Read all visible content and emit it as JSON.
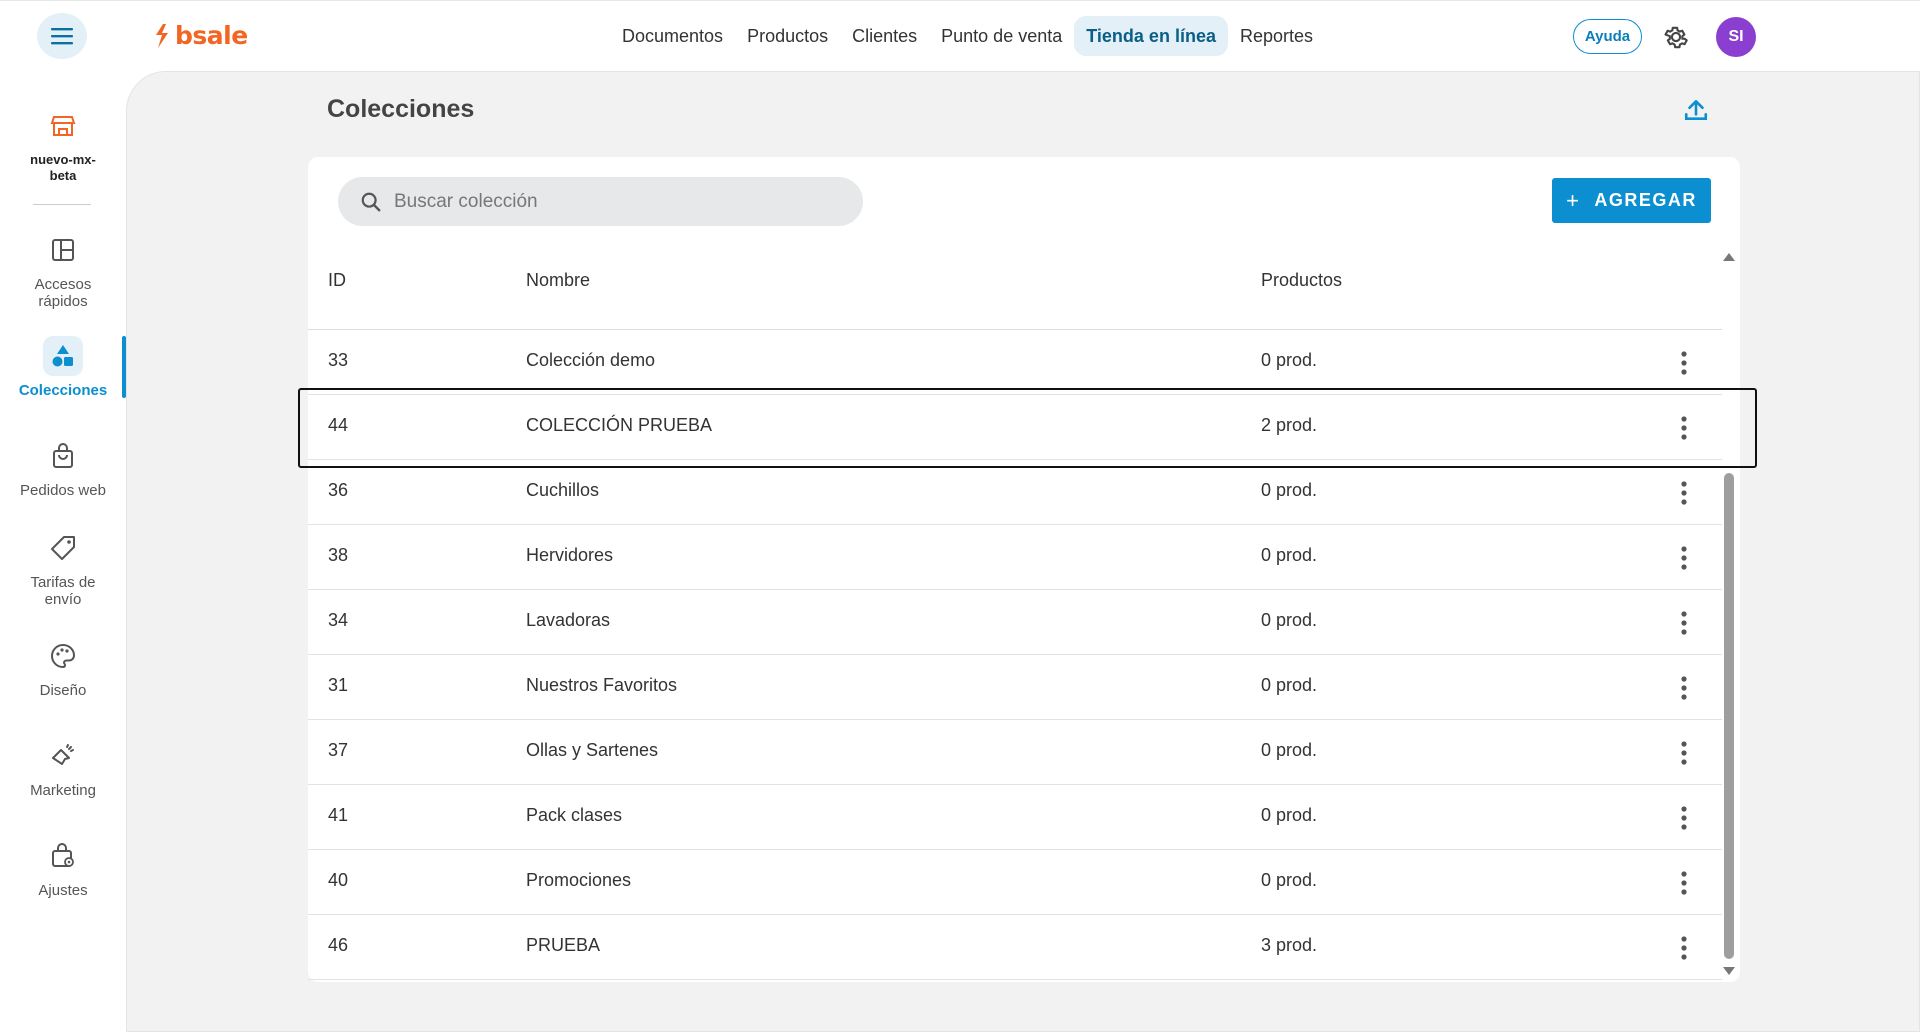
{
  "header": {
    "logo_text": "bsale",
    "nav": [
      {
        "label": "Documentos"
      },
      {
        "label": "Productos"
      },
      {
        "label": "Clientes"
      },
      {
        "label": "Punto de venta"
      },
      {
        "label": "Tienda en línea"
      },
      {
        "label": "Reportes"
      }
    ],
    "active_nav": "Tienda en línea",
    "help_label": "Ayuda",
    "avatar_initials": "SI"
  },
  "sidebar": {
    "store_name_line1": "nuevo-mx-",
    "store_name_line2": "beta",
    "items": [
      {
        "label1": "Accesos",
        "label2": "rápidos",
        "icon": "layout-icon"
      },
      {
        "label1": "Colecciones",
        "label2": "",
        "icon": "shapes-icon"
      },
      {
        "label1": "Pedidos web",
        "label2": "",
        "icon": "shopping-bag-icon"
      },
      {
        "label1": "Tarifas de",
        "label2": "envío",
        "icon": "tag-icon"
      },
      {
        "label1": "Diseño",
        "label2": "",
        "icon": "palette-icon"
      },
      {
        "label1": "Marketing",
        "label2": "",
        "icon": "megaphone-icon"
      },
      {
        "label1": "Ajustes",
        "label2": "",
        "icon": "settings-bag-icon"
      }
    ],
    "active_item": "Colecciones"
  },
  "main": {
    "title": "Colecciones",
    "search_placeholder": "Buscar colección",
    "add_label": "AGREGAR",
    "columns": {
      "id": "ID",
      "name": "Nombre",
      "products": "Productos"
    },
    "rows": [
      {
        "id": "33",
        "name": "Colección demo",
        "products": "0 prod."
      },
      {
        "id": "44",
        "name": "COLECCIÓN PRUEBA",
        "products": "2 prod."
      },
      {
        "id": "36",
        "name": "Cuchillos",
        "products": "0 prod."
      },
      {
        "id": "38",
        "name": "Hervidores",
        "products": "0 prod."
      },
      {
        "id": "34",
        "name": "Lavadoras",
        "products": "0 prod."
      },
      {
        "id": "31",
        "name": "Nuestros Favoritos",
        "products": "0 prod."
      },
      {
        "id": "37",
        "name": "Ollas y Sartenes",
        "products": "0 prod."
      },
      {
        "id": "41",
        "name": "Pack clases",
        "products": "0 prod."
      },
      {
        "id": "40",
        "name": "Promociones",
        "products": "0 prod."
      },
      {
        "id": "46",
        "name": "PRUEBA",
        "products": "3 prod."
      }
    ]
  },
  "colors": {
    "accent": "#0b8fd0",
    "brand": "#f26522",
    "avatar": "#8a3fd1"
  }
}
